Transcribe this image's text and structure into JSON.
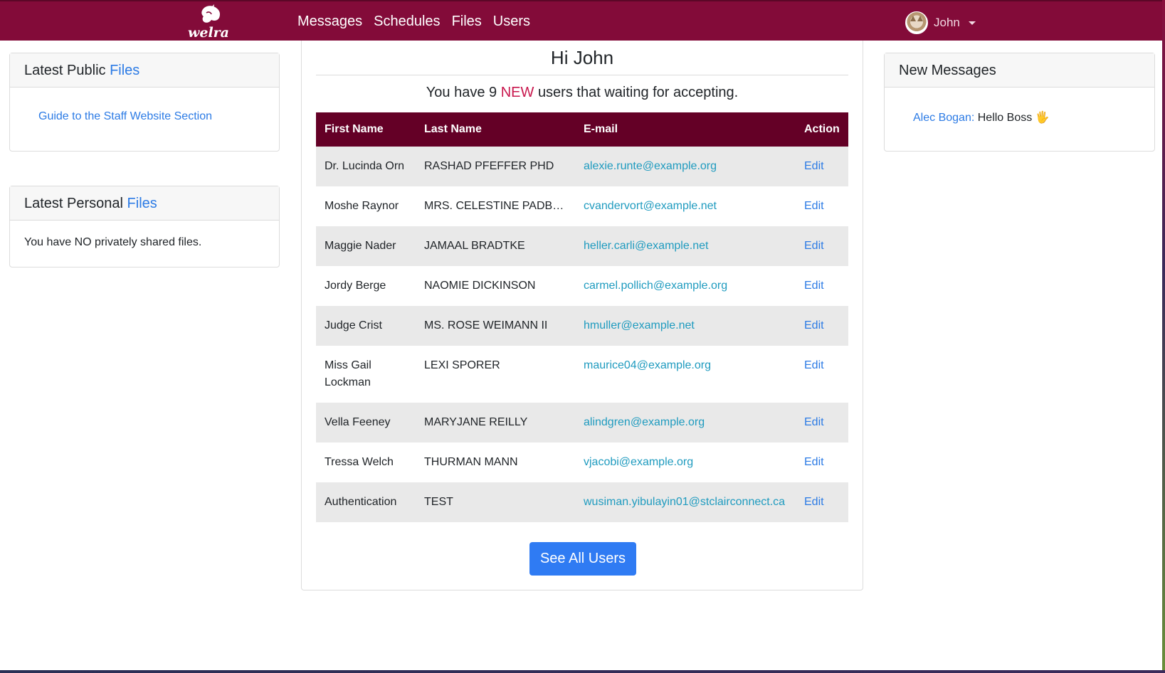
{
  "navbar": {
    "brand": "welra",
    "links": [
      "Messages",
      "Schedules",
      "Files",
      "Users"
    ],
    "user_name": "John",
    "colors": {
      "bar": "#830b39"
    }
  },
  "public_files": {
    "title_prefix": "Latest Public",
    "title_link": "Files",
    "items": [
      "Guide to the Staff Website Section"
    ]
  },
  "personal_files": {
    "title_prefix": "Latest Personal",
    "title_link": "Files",
    "empty_text": "You have NO privately shared files."
  },
  "main": {
    "greeting": "Hi John",
    "notice_prefix": "You have 9",
    "notice_highlight": "NEW",
    "notice_suffix": "users that waiting for accepting.",
    "see_all_label": "See All Users"
  },
  "table": {
    "headers": [
      "First Name",
      "Last Name",
      "E-mail",
      "Action"
    ],
    "rows": [
      {
        "first": "Dr. Lucinda Orn",
        "last": "RASHAD PFEFFER PHD",
        "email": "alexie.runte@example.org",
        "action": "Edit"
      },
      {
        "first": "Moshe Raynor",
        "last": "MRS. CELESTINE PADBE...",
        "email": "cvandervort@example.net",
        "action": "Edit"
      },
      {
        "first": "Maggie Nader",
        "last": "JAMAAL BRADTKE",
        "email": "heller.carli@example.net",
        "action": "Edit"
      },
      {
        "first": "Jordy Berge",
        "last": "NAOMIE DICKINSON",
        "email": "carmel.pollich@example.org",
        "action": "Edit"
      },
      {
        "first": "Judge Crist",
        "last": "MS. ROSE WEIMANN II",
        "email": "hmuller@example.net",
        "action": "Edit"
      },
      {
        "first": "Miss Gail Lockman",
        "last": "LEXI SPORER",
        "email": "maurice04@example.org",
        "action": "Edit"
      },
      {
        "first": "Vella Feeney",
        "last": "MARYJANE REILLY",
        "email": "alindgren@example.org",
        "action": "Edit"
      },
      {
        "first": "Tressa Welch",
        "last": "THURMAN MANN",
        "email": "vjacobi@example.org",
        "action": "Edit"
      },
      {
        "first": "Authentication",
        "last": "TEST",
        "email": "wusiman.yibulayin01@stclairconnect.ca",
        "action": "Edit"
      }
    ]
  },
  "messages": {
    "title": "New Messages",
    "items": [
      {
        "sender": "Alec Bogan:",
        "text": "Hello Boss",
        "emoji": "🖐"
      }
    ]
  }
}
